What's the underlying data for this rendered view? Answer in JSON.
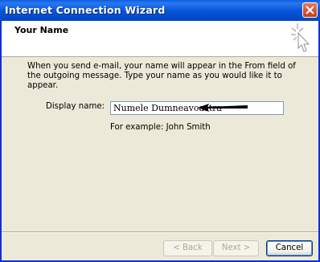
{
  "window": {
    "title": "Internet Connection Wizard",
    "close_icon": "close-icon"
  },
  "header": {
    "title": "Your Name",
    "icon": "wizard-sparkle-cursor-icon"
  },
  "main": {
    "description": "When you send e-mail, your name will appear in the From field of the outgoing message. Type your name as you would like it to appear.",
    "display_name_label": "Display name:",
    "display_name_value": "Numele Dumneavoastra",
    "example_text": "For example: John Smith",
    "annotation": "black-arrow-pointing-left"
  },
  "buttons": {
    "back": "< Back",
    "next": "Next >",
    "cancel": "Cancel"
  },
  "colors": {
    "titlebar": "#0553d8",
    "dialog_bg": "#ece9d8",
    "close_button": "#c63b1c"
  }
}
